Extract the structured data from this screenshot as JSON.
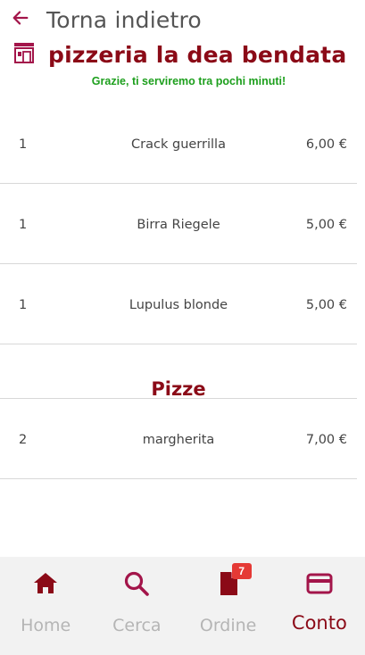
{
  "header": {
    "back_label": "Torna indietro",
    "restaurant_name": "pizzeria la dea bendata",
    "thanks_message": "Grazie, ti serviremo tra pochi minuti!"
  },
  "order": {
    "items": [
      {
        "qty": "1",
        "name": "Crack guerrilla",
        "price": "6,00 €"
      },
      {
        "qty": "1",
        "name": "Birra Riegele",
        "price": "5,00 €"
      },
      {
        "qty": "1",
        "name": "Lupulus blonde",
        "price": "5,00 €"
      }
    ],
    "section_title": "Pizze",
    "pizza_items": [
      {
        "qty": "2",
        "name": "margherita",
        "price": "7,00 €"
      }
    ]
  },
  "bottom_nav": {
    "items": [
      {
        "label": "Home",
        "icon": "home-icon"
      },
      {
        "label": "Cerca",
        "icon": "search-icon"
      },
      {
        "label": "Ordine",
        "icon": "document-icon",
        "badge": "7"
      },
      {
        "label": "Conto",
        "icon": "credit-card-icon"
      }
    ],
    "active": "Conto"
  },
  "colors": {
    "brand": "#8b0a17",
    "accent": "#a3154a",
    "success": "#1d9f1d",
    "badge": "#e53935",
    "inactive": "#b5b5b5"
  }
}
